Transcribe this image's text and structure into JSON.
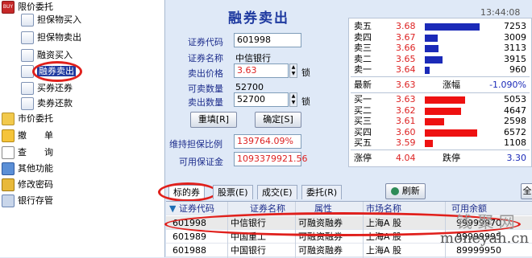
{
  "time": "13:44:08",
  "tree": {
    "items": [
      {
        "label": "限价委托"
      },
      {
        "label": "担保物买入"
      },
      {
        "label": "担保物卖出"
      },
      {
        "label": "融资买入"
      },
      {
        "label": "融券卖出"
      },
      {
        "label": "买券还券"
      },
      {
        "label": "卖券还款"
      },
      {
        "label": "市价委托"
      },
      {
        "label": "撤　　单"
      },
      {
        "label": "查　　询"
      },
      {
        "label": "其他功能"
      },
      {
        "label": "修改密码"
      },
      {
        "label": "银行存管"
      }
    ]
  },
  "form": {
    "title": "融券卖出",
    "code_label": "证券代码",
    "code_value": "601998",
    "name_label": "证券名称",
    "name_value": "中信银行",
    "price_label": "卖出价格",
    "price_value": "3.63",
    "lock1": "锁",
    "avail_label": "可卖数量",
    "avail_value": "52700",
    "qty_label": "卖出数量",
    "qty_value": "52700",
    "lock2": "锁",
    "reset_btn": "重填[R]",
    "confirm_btn": "确定[S]",
    "ratio_label": "维持担保比例",
    "ratio_value": "139764.09%",
    "margin_label": "可用保证金",
    "margin_value": "1093379921.56"
  },
  "quote": {
    "sells": [
      {
        "name": "卖五",
        "price": "3.68",
        "vol": "7253",
        "level": 0.95
      },
      {
        "name": "卖四",
        "price": "3.67",
        "vol": "3009",
        "level": 0.22
      },
      {
        "name": "卖三",
        "price": "3.66",
        "vol": "3113",
        "level": 0.24
      },
      {
        "name": "卖二",
        "price": "3.65",
        "vol": "3915",
        "level": 0.3
      },
      {
        "name": "卖一",
        "price": "3.64",
        "vol": "960",
        "level": 0.08
      }
    ],
    "last_label": "最新",
    "last_value": "3.63",
    "chg_label": "涨幅",
    "chg_value": "-1.090%",
    "buys": [
      {
        "name": "买一",
        "price": "3.63",
        "vol": "5053",
        "level": 0.7
      },
      {
        "name": "买二",
        "price": "3.62",
        "vol": "4647",
        "level": 0.63
      },
      {
        "name": "买三",
        "price": "3.61",
        "vol": "2598",
        "level": 0.34
      },
      {
        "name": "买四",
        "price": "3.60",
        "vol": "6572",
        "level": 0.9
      },
      {
        "name": "买五",
        "price": "3.59",
        "vol": "1108",
        "level": 0.14
      }
    ],
    "limit_up_label": "涨停",
    "limit_up_value": "4.04",
    "limit_down_label": "跌停",
    "limit_down_value": "3.30"
  },
  "tabs": [
    "标的券",
    "股票(E)",
    "成交(E)",
    "委托(R)"
  ],
  "refresh": "刷新",
  "more_btn": "全",
  "table": {
    "headers": [
      "证券代码",
      "证券名称",
      "属性",
      "市场名称",
      "可用余额"
    ],
    "rows": [
      [
        "601998",
        "中信银行",
        "可融资融券",
        "上海A 股",
        "99999970"
      ],
      [
        "601989",
        "中国重工",
        "可融资融券",
        "上海A 股",
        "99999995"
      ],
      [
        "601988",
        "中国银行",
        "可融资融券",
        "上海A 股",
        "89999950"
      ]
    ]
  },
  "watermark1": "钱·聚·网",
  "watermark2": "moneyah.cn"
}
